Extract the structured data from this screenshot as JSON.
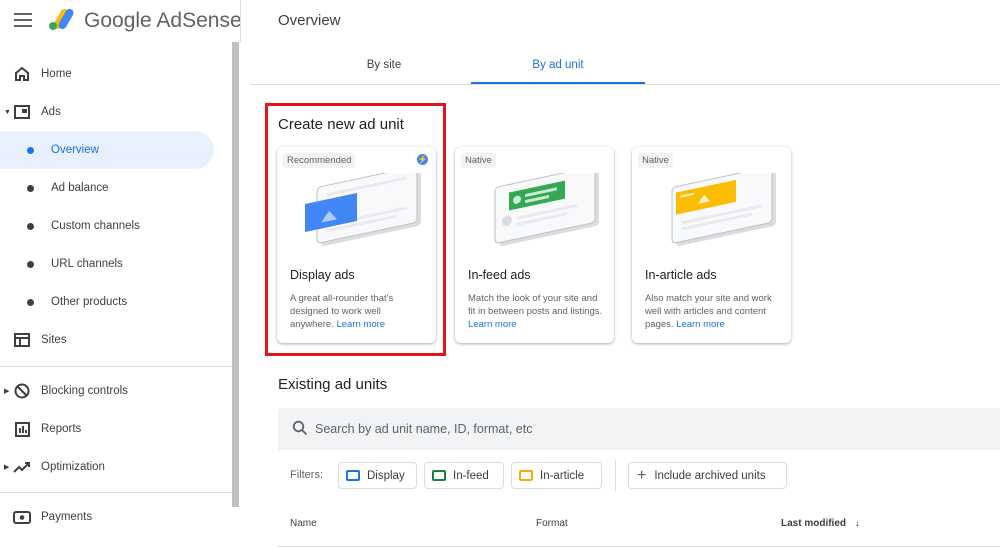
{
  "app": {
    "brand": "Google AdSense",
    "page_title": "Overview"
  },
  "icons": {
    "menu": "hamburger-icon",
    "logo": "adsense-logo"
  },
  "sidebar": {
    "items": [
      {
        "label": "Home",
        "icon": "home-icon"
      },
      {
        "label": "Ads",
        "icon": "ads-icon"
      },
      {
        "label": "Overview"
      },
      {
        "label": "Ad balance"
      },
      {
        "label": "Custom channels"
      },
      {
        "label": "URL channels"
      },
      {
        "label": "Other products"
      },
      {
        "label": "Sites",
        "icon": "sites-icon"
      },
      {
        "label": "Blocking controls",
        "icon": "block-icon"
      },
      {
        "label": "Reports",
        "icon": "reports-icon"
      },
      {
        "label": "Optimization",
        "icon": "trending-icon"
      },
      {
        "label": "Payments",
        "icon": "payments-icon"
      }
    ],
    "active": "Overview"
  },
  "tabs": [
    {
      "label": "By site"
    },
    {
      "label": "By ad unit"
    }
  ],
  "active_tab": "By ad unit",
  "create": {
    "title": "Create new ad unit",
    "cards": [
      {
        "chip": "Recommended",
        "title": "Display ads",
        "desc": "A great all-rounder that's designed to work well anywhere.",
        "link": "Learn more",
        "accent": "#4285f4"
      },
      {
        "chip": "Native",
        "title": "In-feed ads",
        "desc": "Match the look of your site and fit in between posts and listings.",
        "link": "Learn more",
        "accent": "#34a853"
      },
      {
        "chip": "Native",
        "title": "In-article ads",
        "desc": "Also match your site and work well with articles and content pages.",
        "link": "Learn more",
        "accent": "#fbbc04"
      }
    ]
  },
  "existing": {
    "title": "Existing ad units",
    "search_placeholder": "Search by ad unit name, ID, format, etc",
    "filters_label": "Filters:",
    "filters": [
      {
        "label": "Display",
        "color": "#1a73e8"
      },
      {
        "label": "In-feed",
        "color": "#188038"
      },
      {
        "label": "In-article",
        "color": "#f9ab00"
      }
    ],
    "archived_label": "Include archived units",
    "columns": [
      "Name",
      "Format",
      "Last modified"
    ]
  },
  "colors": {
    "accent": "#1a73e8",
    "highlight": "#e3141b"
  }
}
